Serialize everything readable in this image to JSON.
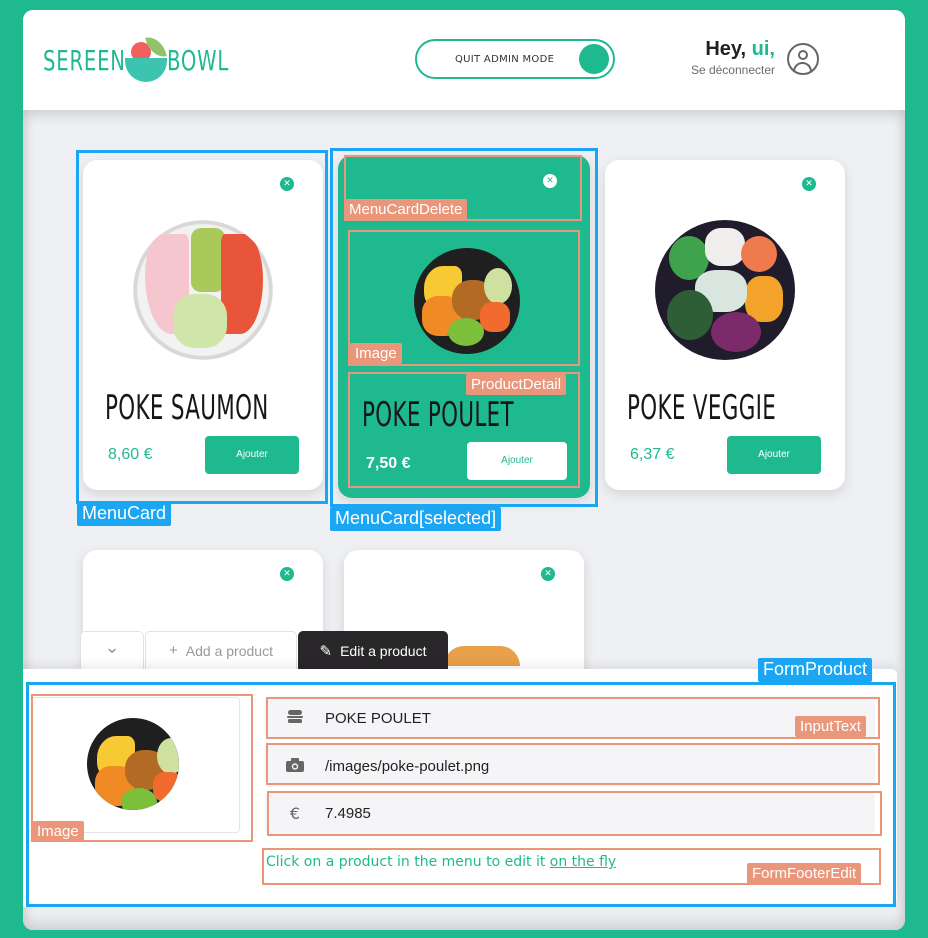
{
  "header": {
    "logo_left": "SEREEN",
    "logo_right": "BOWL",
    "admin_toggle_label": "QUIT ADMIN MODE",
    "greeting": "Hey, ",
    "user_name": "ui,",
    "logout_label": "Se déconnecter"
  },
  "menu": {
    "cards": [
      {
        "title": "POKE SAUMON",
        "price": "8,60 €",
        "add_label": "Ajouter",
        "delete_icon": "✕",
        "selected": false
      },
      {
        "title": "POKE POULET",
        "price": "7,50 €",
        "add_label": "Ajouter",
        "delete_icon": "✕",
        "selected": true
      },
      {
        "title": "POKE VEGGIE",
        "price": "6,37 €",
        "add_label": "Ajouter",
        "delete_icon": "✕",
        "selected": false
      },
      {
        "title": "",
        "price": "",
        "add_label": "",
        "delete_icon": "✕",
        "selected": false
      },
      {
        "title": "",
        "price": "",
        "add_label": "",
        "delete_icon": "✕",
        "selected": false
      }
    ]
  },
  "tabs": {
    "collapse_icon": "⌄",
    "add_icon": "+",
    "add_label": "Add a product",
    "edit_icon": "✎",
    "edit_label": "Edit a product"
  },
  "form": {
    "name_icon": "burger-icon",
    "name_value": "POKE POULET",
    "image_icon": "camera-icon",
    "image_value": "/images/poke-poulet.png",
    "price_icon": "€",
    "price_value": "7.4985",
    "footer_text": "Click on a product in the menu to edit it ",
    "footer_link": "on the fly"
  },
  "annotations": {
    "menu_card": "MenuCard",
    "menu_card_selected": "MenuCard[selected]",
    "menu_card_delete": "MenuCardDelete",
    "image": "Image",
    "product_detail": "ProductDetail",
    "form_product": "FormProduct",
    "input_text": "InputText",
    "form_image": "Image",
    "form_footer_edit": "FormFooterEdit"
  },
  "colors": {
    "accent": "#1fb990",
    "annotation_blue": "#1aa6f2",
    "annotation_orange": "#e9967a"
  }
}
